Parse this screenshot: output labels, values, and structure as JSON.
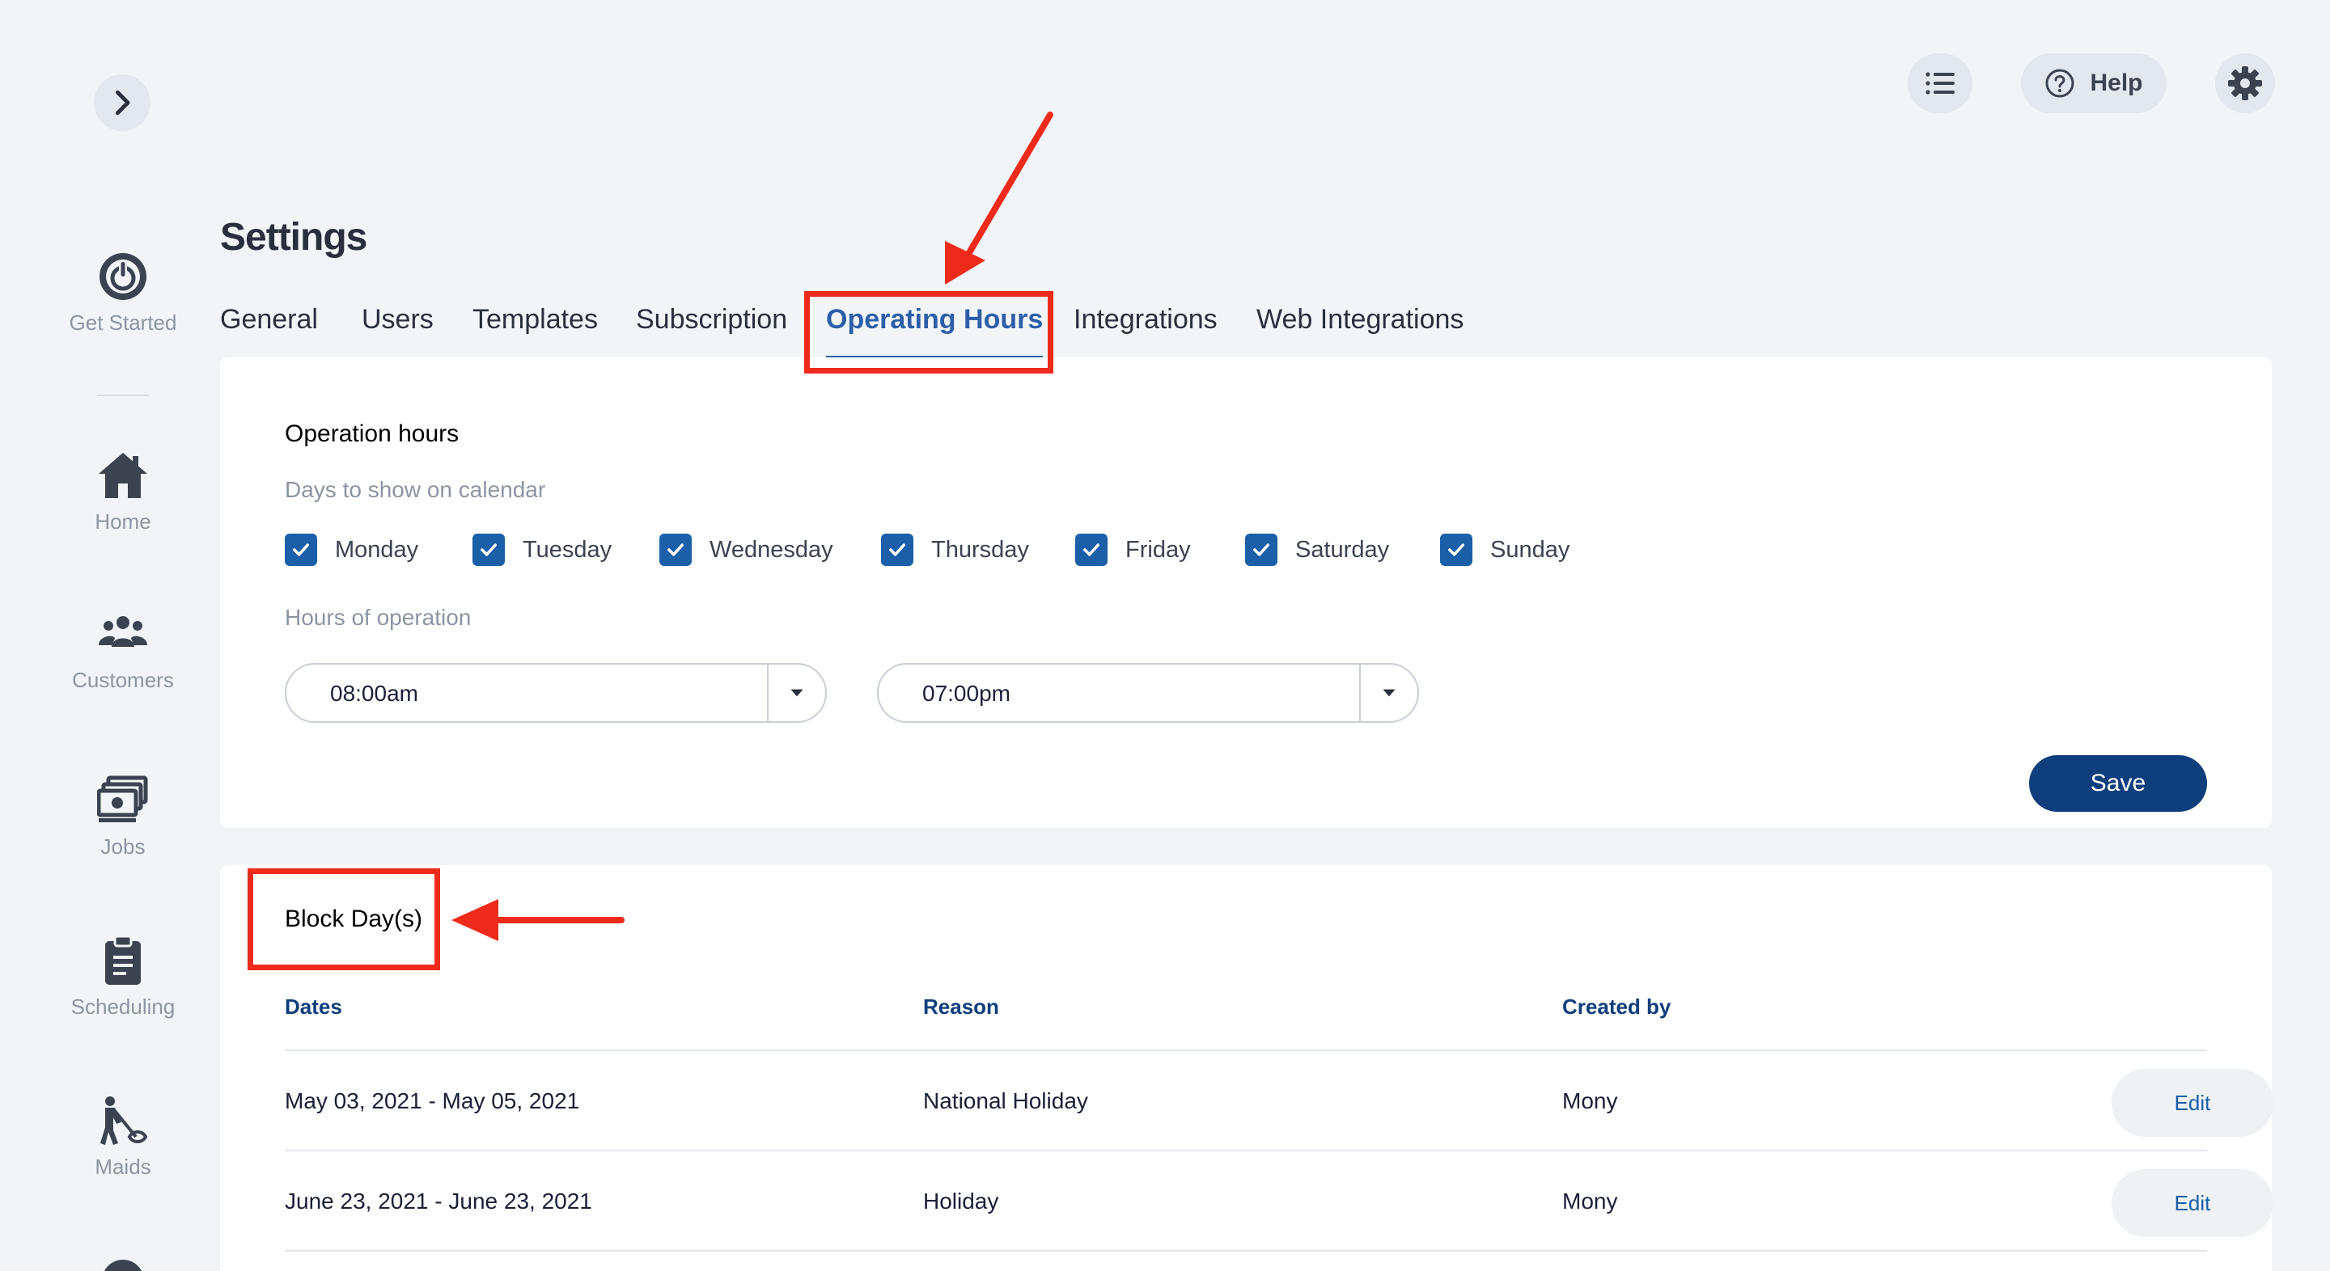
{
  "sidebar": {
    "items": [
      {
        "label": "Get Started",
        "icon": "power-icon"
      },
      {
        "label": "Home",
        "icon": "home-icon"
      },
      {
        "label": "Customers",
        "icon": "people-icon"
      },
      {
        "label": "Jobs",
        "icon": "money-icon"
      },
      {
        "label": "Scheduling",
        "icon": "clipboard-icon"
      },
      {
        "label": "Maids",
        "icon": "cleaner-icon"
      }
    ]
  },
  "topbar": {
    "help_label": "Help"
  },
  "page": {
    "title": "Settings"
  },
  "tabs": [
    {
      "label": "General"
    },
    {
      "label": "Users"
    },
    {
      "label": "Templates"
    },
    {
      "label": "Subscription"
    },
    {
      "label": "Operating Hours",
      "active": true
    },
    {
      "label": "Integrations"
    },
    {
      "label": "Web Integrations"
    }
  ],
  "operation": {
    "title": "Operation hours",
    "days_label": "Days to show on calendar",
    "days": [
      {
        "label": "Monday",
        "checked": true
      },
      {
        "label": "Tuesday",
        "checked": true
      },
      {
        "label": "Wednesday",
        "checked": true
      },
      {
        "label": "Thursday",
        "checked": true
      },
      {
        "label": "Friday",
        "checked": true
      },
      {
        "label": "Saturday",
        "checked": true
      },
      {
        "label": "Sunday",
        "checked": true
      }
    ],
    "hours_label": "Hours of operation",
    "start_time": "08:00am",
    "end_time": "07:00pm",
    "save_label": "Save"
  },
  "block_days": {
    "title": "Block Day(s)",
    "columns": [
      "Dates",
      "Reason",
      "Created by"
    ],
    "rows": [
      {
        "dates": "May 03, 2021 - May 05, 2021",
        "reason": "National Holiday",
        "created_by": "Mony",
        "action": "Edit"
      },
      {
        "dates": "June 23, 2021 - June 23, 2021",
        "reason": "Holiday",
        "created_by": "Mony",
        "action": "Edit"
      }
    ]
  },
  "colors": {
    "accent": "#1a5fa8",
    "primary_dark": "#0f3e7c",
    "annotation_red": "#ee2a1b",
    "background": "#f1f5f8"
  }
}
